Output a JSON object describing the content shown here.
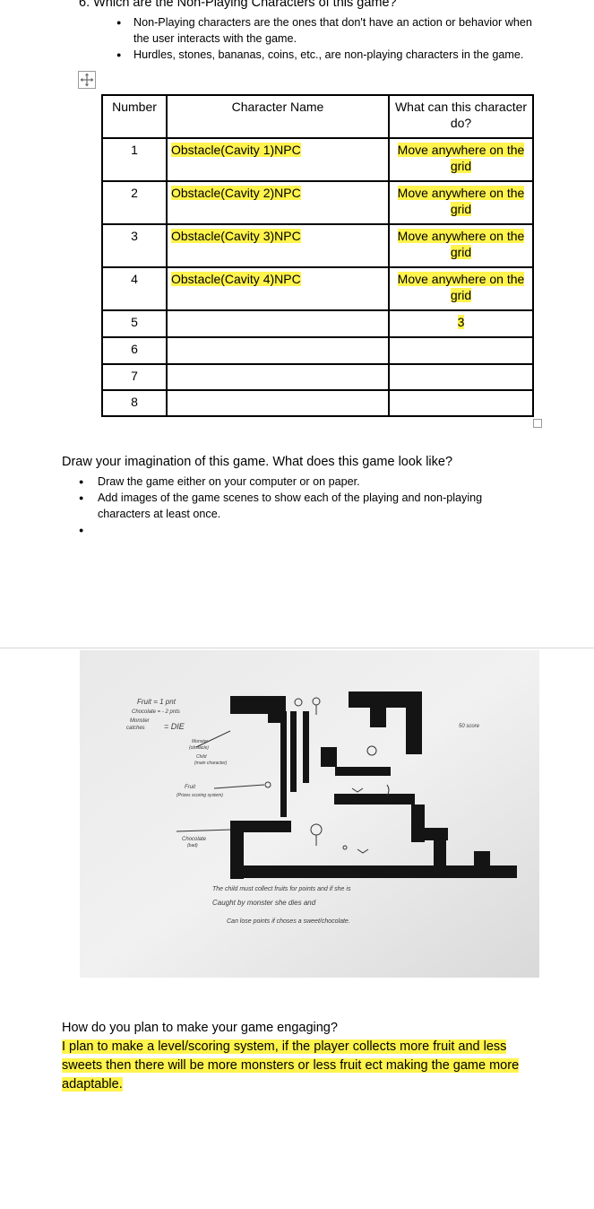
{
  "question6": {
    "title": "6. Which are the Non-Playing Characters of this game?",
    "bullets": [
      "Non-Playing characters are the ones that don't have an action or behavior when the user interacts with the game.",
      "Hurdles, stones, bananas, coins, etc., are non-playing characters in the game."
    ]
  },
  "npc_table": {
    "headers": [
      "Number",
      "Character Name",
      "What can this character do?"
    ],
    "rows": [
      {
        "number": "1",
        "name": "Obstacle(Cavity 1)NPC",
        "action": "Move anywhere on the grid"
      },
      {
        "number": "2",
        "name": "Obstacle(Cavity 2)NPC",
        "action": "Move anywhere on the grid"
      },
      {
        "number": "3",
        "name": "Obstacle(Cavity 3)NPC",
        "action": "Move anywhere on the grid"
      },
      {
        "number": "4",
        "name": "Obstacle(Cavity 4)NPC",
        "action": "Move anywhere on the grid"
      },
      {
        "number": "5",
        "name": "",
        "action": "3"
      },
      {
        "number": "6",
        "name": "",
        "action": ""
      },
      {
        "number": "7",
        "name": "",
        "action": ""
      },
      {
        "number": "8",
        "name": "",
        "action": ""
      }
    ]
  },
  "draw_section": {
    "title": "Draw your imagination of this game. What does this game look like?",
    "bullets": [
      "Draw the game either on your computer or on paper.",
      "Add images of the game scenes to show each of the playing and non-playing characters at least once.",
      ""
    ]
  },
  "photo": {
    "legend_fruit": "Fruit = 1 pnt",
    "legend_chocolate": "Chocolate = - 2 pnts",
    "legend_monster": "Monster",
    "legend_catches": "catches",
    "legend_die": "= DIE",
    "label_monster": "Monster",
    "label_monster_sub": "(obstacle)",
    "label_child": "Child",
    "label_child_sub": "(main character)",
    "label_fruit": "Fruit",
    "label_fruit_sub": "(Prizes scoring system)",
    "label_chocolate": "Chocolate",
    "label_chocolate_sub": "(bad)",
    "label_score": "50 score",
    "caption_line1": "The child must collect fruits for points and if she is",
    "caption_line2": "Caught by monster she dies and",
    "caption_line3": "Can lose points if choses a sweet/chocolate."
  },
  "engagement": {
    "question": "How do you plan to make your game engaging?",
    "answer": "I plan to make a level/scoring system, if the player collects more fruit and less sweets then there will be more monsters or less fruit ect making the game more adaptable."
  }
}
